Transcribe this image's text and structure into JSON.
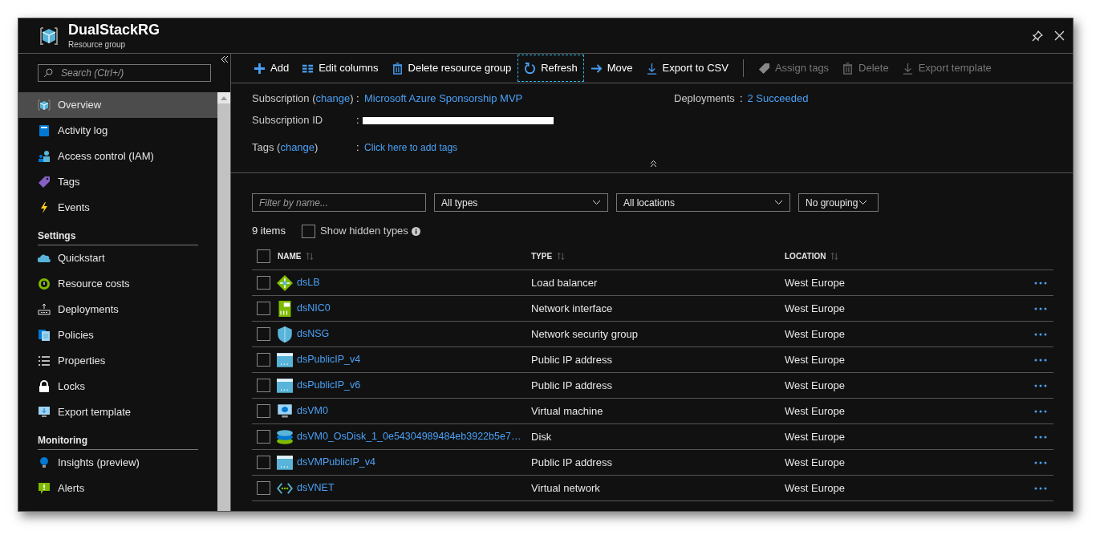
{
  "header": {
    "title": "DualStackRG",
    "subtitle": "Resource group"
  },
  "sidebar": {
    "search_placeholder": "Search (Ctrl+/)",
    "sections": [
      {
        "items": [
          {
            "label": "Overview",
            "kind": "cube",
            "selected": true
          },
          {
            "label": "Activity log",
            "kind": "log",
            "selected": false
          },
          {
            "label": "Access control (IAM)",
            "kind": "people",
            "selected": false
          },
          {
            "label": "Tags",
            "kind": "tag",
            "selected": false
          },
          {
            "label": "Events",
            "kind": "bolt",
            "selected": false
          }
        ]
      },
      {
        "heading": "Settings",
        "items": [
          {
            "label": "Quickstart",
            "kind": "cloud",
            "selected": false
          },
          {
            "label": "Resource costs",
            "kind": "costs",
            "selected": false
          },
          {
            "label": "Deployments",
            "kind": "deploy",
            "selected": false
          },
          {
            "label": "Policies",
            "kind": "docs",
            "selected": false
          },
          {
            "label": "Properties",
            "kind": "list",
            "selected": false
          },
          {
            "label": "Locks",
            "kind": "lock",
            "selected": false
          },
          {
            "label": "Export template",
            "kind": "monitor",
            "selected": false
          }
        ]
      },
      {
        "heading": "Monitoring",
        "items": [
          {
            "label": "Insights (preview)",
            "kind": "bulb",
            "selected": false
          },
          {
            "label": "Alerts",
            "kind": "alert",
            "selected": false
          }
        ]
      }
    ]
  },
  "toolbar": {
    "groups": [
      [
        {
          "label": "Add",
          "kind": "plus",
          "disabled": false,
          "focused": false
        },
        {
          "label": "Edit columns",
          "kind": "columns",
          "disabled": false,
          "focused": false
        },
        {
          "label": "Delete resource group",
          "kind": "trash",
          "disabled": false,
          "focused": false
        },
        {
          "label": "Refresh",
          "kind": "refresh",
          "disabled": false,
          "focused": true
        },
        {
          "label": "Move",
          "kind": "arrow",
          "disabled": false,
          "focused": false
        },
        {
          "label": "Export to CSV",
          "kind": "download",
          "disabled": false,
          "focused": false
        }
      ],
      [
        {
          "label": "Assign tags",
          "kind": "tag",
          "disabled": true,
          "focused": false
        },
        {
          "label": "Delete",
          "kind": "trash",
          "disabled": true,
          "focused": false
        },
        {
          "label": "Export template",
          "kind": "download",
          "disabled": true,
          "focused": false
        }
      ]
    ]
  },
  "essentials": {
    "subscription_label": {
      "before": "Subscription (",
      "link": "change",
      "after": ")"
    },
    "subscription_colon": ":",
    "subscription_value": "Microsoft Azure Sponsorship MVP",
    "subscription_id_label": "Subscription ID",
    "subscription_id_colon": ":",
    "tags_label": {
      "before": "Tags (",
      "link": "change",
      "after": ")"
    },
    "tags_colon": ":",
    "tags_value": "Click here to add tags",
    "deployments_label": "Deployments",
    "deployments_colon": ":",
    "deployments_value": "2 Succeeded"
  },
  "filters": {
    "name_placeholder": "Filter by name...",
    "types": "All types",
    "locations": "All locations",
    "grouping": "No grouping"
  },
  "summary": {
    "count": "9 items",
    "show_hidden_label": "Show hidden types",
    "show_hidden_checked": false
  },
  "table": {
    "all_checked": false,
    "columns": [
      "NAME",
      "TYPE",
      "LOCATION"
    ],
    "rows": [
      {
        "name": "dsLB",
        "type": "Load balancer",
        "location": "West Europe",
        "kind": "lb",
        "checked": false
      },
      {
        "name": "dsNIC0",
        "type": "Network interface",
        "location": "West Europe",
        "kind": "nic",
        "checked": false
      },
      {
        "name": "dsNSG",
        "type": "Network security group",
        "location": "West Europe",
        "kind": "nsg",
        "checked": false
      },
      {
        "name": "dsPublicIP_v4",
        "type": "Public IP address",
        "location": "West Europe",
        "kind": "pip",
        "checked": false
      },
      {
        "name": "dsPublicIP_v6",
        "type": "Public IP address",
        "location": "West Europe",
        "kind": "pip",
        "checked": false
      },
      {
        "name": "dsVM0",
        "type": "Virtual machine",
        "location": "West Europe",
        "kind": "vm",
        "checked": false
      },
      {
        "name": "dsVM0_OsDisk_1_0e54304989484eb3922b5e7…",
        "type": "Disk",
        "location": "West Europe",
        "kind": "disk",
        "checked": false
      },
      {
        "name": "dsVMPublicIP_v4",
        "type": "Public IP address",
        "location": "West Europe",
        "kind": "pip",
        "checked": false
      },
      {
        "name": "dsVNET",
        "type": "Virtual network",
        "location": "West Europe",
        "kind": "vnet",
        "checked": false
      }
    ]
  }
}
